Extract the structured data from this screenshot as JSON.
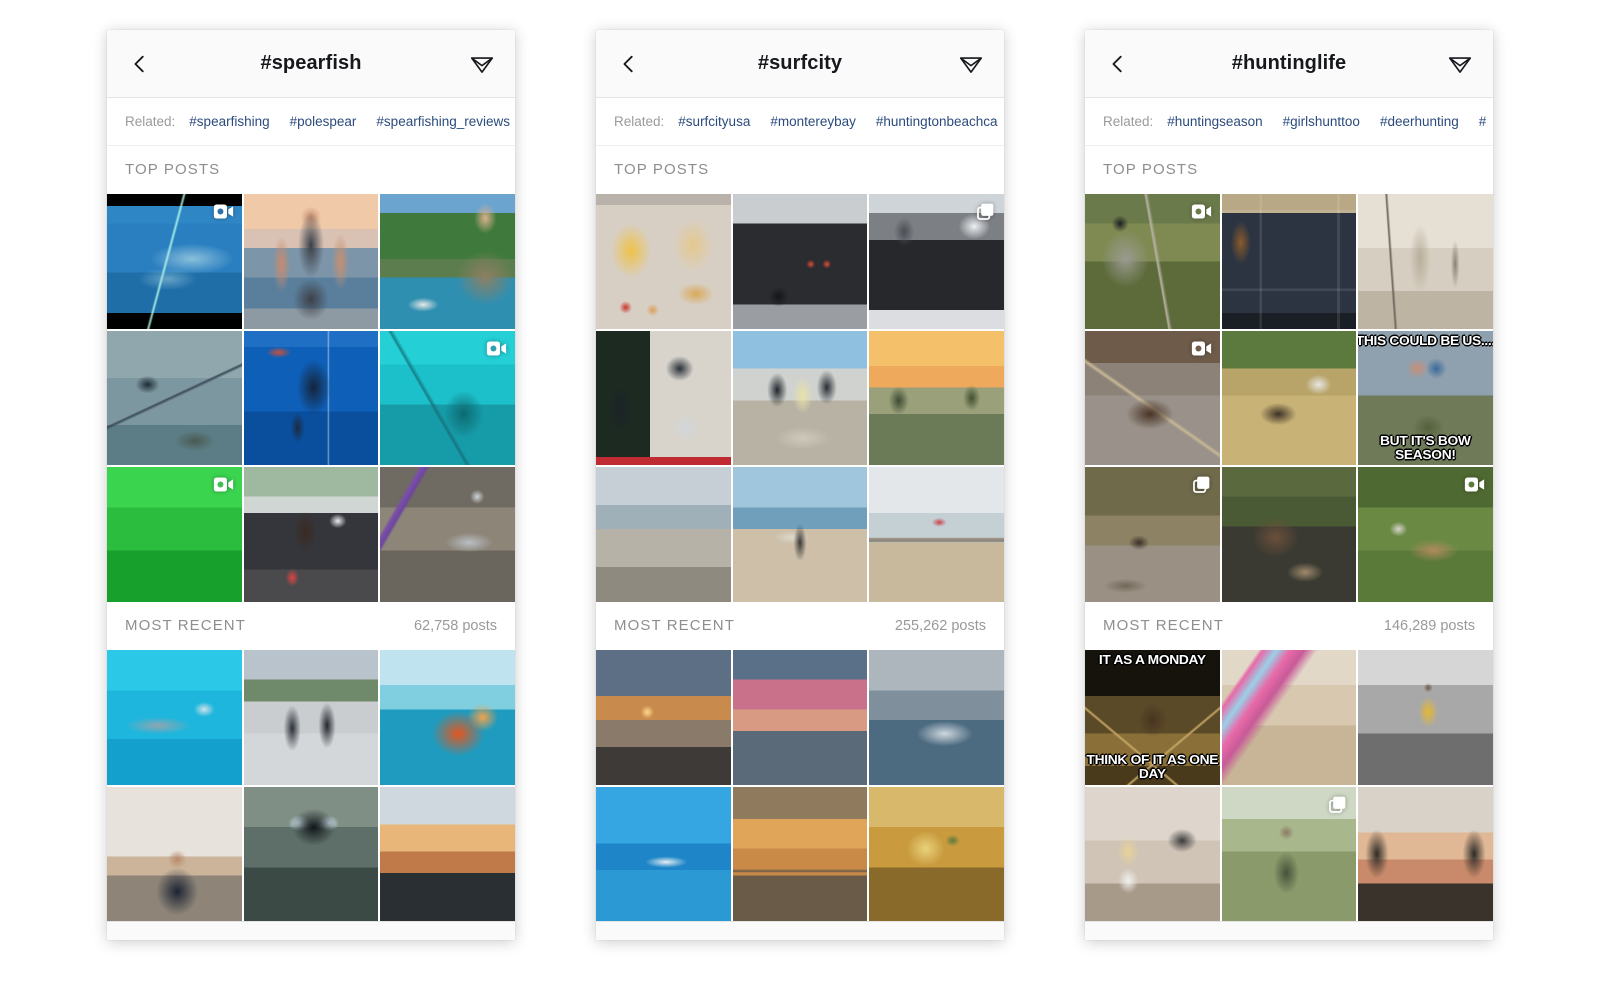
{
  "panels": [
    {
      "id": "spearfish",
      "header": {
        "back_icon": "chevron-left-icon",
        "title": "#spearfish",
        "share_icon": "direct-share-icon"
      },
      "related": {
        "label": "Related:",
        "tags": [
          "#spearfishing",
          "#polespear",
          "#spearfishing_reviews"
        ]
      },
      "top_section": {
        "title": "TOP POSTS"
      },
      "recent_section": {
        "title": "MOST RECENT",
        "count": "62,758 posts"
      },
      "top_posts": [
        {
          "alt": "underwater spearfishing video of fish",
          "badge": "video-icon"
        },
        {
          "alt": "diver holding string of snapper fish on boat",
          "badge": ""
        },
        {
          "alt": "cliff jumper above rocky shoreline",
          "badge": ""
        },
        {
          "alt": "freediver descending over sandy seabed",
          "badge": ""
        },
        {
          "alt": "spearfisher at surface with speargun in blue water",
          "badge": ""
        },
        {
          "alt": "diver in teal water near shipwreck",
          "badge": "video-icon"
        },
        {
          "alt": "green murky water video",
          "badge": "video-icon"
        },
        {
          "alt": "woman with speargun at truck tailgate",
          "badge": ""
        },
        {
          "alt": "speared fish on rocks with purple gun",
          "badge": ""
        }
      ],
      "recent_posts": [
        {
          "alt": "sharks swimming in clear blue water",
          "badge": ""
        },
        {
          "alt": "couple on dock holding fish and pole spear",
          "badge": ""
        },
        {
          "alt": "lionfish held up against the sea",
          "badge": ""
        },
        {
          "alt": "bearded man in hoodie at dusk",
          "badge": ""
        },
        {
          "alt": "diver in mask and wetsuit selfie",
          "badge": ""
        },
        {
          "alt": "sunset over silhouetted trees",
          "badge": ""
        }
      ],
      "tabbar": [
        "home-icon",
        "search-icon",
        "add-post-icon",
        "activity-heart-icon"
      ]
    },
    {
      "id": "surfcity",
      "header": {
        "back_icon": "chevron-left-icon",
        "title": "#surfcity",
        "share_icon": "direct-share-icon"
      },
      "related": {
        "label": "Related:",
        "tags": [
          "#surfcityusa",
          "#montereybay",
          "#huntingtonbeachca"
        ]
      },
      "top_section": {
        "title": "TOP POSTS"
      },
      "recent_section": {
        "title": "MOST RECENT",
        "count": "255,262 posts"
      },
      "top_posts": [
        {
          "alt": "trays of fries burritos and pizza",
          "badge": ""
        },
        {
          "alt": "black muscle car under overpass",
          "badge": ""
        },
        {
          "alt": "hot rod in garage with van",
          "badge": "multi-post-icon"
        },
        {
          "alt": "pageant collage of women with sashes",
          "badge": ""
        },
        {
          "alt": "friends drinking at outdoor table",
          "badge": ""
        },
        {
          "alt": "sunset over palm trees and coastline",
          "badge": ""
        },
        {
          "alt": "grey beach shoreline with driftwood",
          "badge": ""
        },
        {
          "alt": "surfer carrying board on the sand",
          "badge": ""
        },
        {
          "alt": "huntington beach pier from the water",
          "badge": ""
        }
      ],
      "recent_posts": [
        {
          "alt": "sunset over beach with sun on horizon",
          "badge": ""
        },
        {
          "alt": "pink clouds above calm ocean",
          "badge": ""
        },
        {
          "alt": "surfer riding wave near high rise",
          "badge": ""
        },
        {
          "alt": "bright blue wave with distant surfer",
          "badge": ""
        },
        {
          "alt": "orange sunset behind the pier",
          "badge": ""
        },
        {
          "alt": "close up of food on plate",
          "badge": ""
        }
      ],
      "tabbar": [
        "home-icon",
        "search-icon",
        "add-post-icon",
        "activity-heart-icon"
      ]
    },
    {
      "id": "huntinglife",
      "header": {
        "back_icon": "chevron-left-icon",
        "title": "#huntinglife",
        "share_icon": "direct-share-icon"
      },
      "related": {
        "label": "Related:",
        "tags": [
          "#huntingseason",
          "#girlshunttoo",
          "#deerhunting",
          "#"
        ]
      },
      "top_section": {
        "title": "TOP POSTS"
      },
      "recent_section": {
        "title": "MOST RECENT",
        "count": "146,289 posts"
      },
      "top_posts": [
        {
          "alt": "hunter in camo aiming crossbow in woods",
          "badge": "video-icon"
        },
        {
          "alt": "crossbow cases stacked in a truck",
          "badge": ""
        },
        {
          "alt": "vintage photo of hunter holding game",
          "badge": ""
        },
        {
          "alt": "ibex with large horns walking",
          "badge": "video-icon"
        },
        {
          "alt": "boar running across a field",
          "badge": ""
        },
        {
          "alt": "meme couple kissing and bow hunter",
          "badge": "",
          "meme_top": "THIS COULD BE US....",
          "meme_bottom": "BUT IT'S BOW SEASON!"
        },
        {
          "alt": "boar in the brush at dawn",
          "badge": "multi-post-icon"
        },
        {
          "alt": "bear attacking a deer",
          "badge": ""
        },
        {
          "alt": "deer lying in green grass",
          "badge": "video-icon"
        }
      ],
      "recent_posts": [
        {
          "alt": "buck meme think of it as one day",
          "badge": "",
          "meme_top": "IT AS A MONDAY",
          "meme_bottom": "THINK OF IT AS ONE DAY"
        },
        {
          "alt": "pink marbled bow grip on table",
          "badge": ""
        },
        {
          "alt": "man in yellow vest black and white photo",
          "badge": ""
        },
        {
          "alt": "blonde woman smiling at a desk",
          "badge": ""
        },
        {
          "alt": "boy in camo hat outdoors",
          "badge": "multi-post-icon"
        },
        {
          "alt": "sunset through trees on a trail",
          "badge": ""
        }
      ],
      "tabbar": [
        "home-icon",
        "search-icon",
        "add-post-icon",
        "activity-heart-icon"
      ]
    }
  ],
  "colors": {
    "link": "#2b4b7d",
    "muted": "#8e8e8e",
    "text": "#16181c",
    "chrome": "#fafafa"
  }
}
